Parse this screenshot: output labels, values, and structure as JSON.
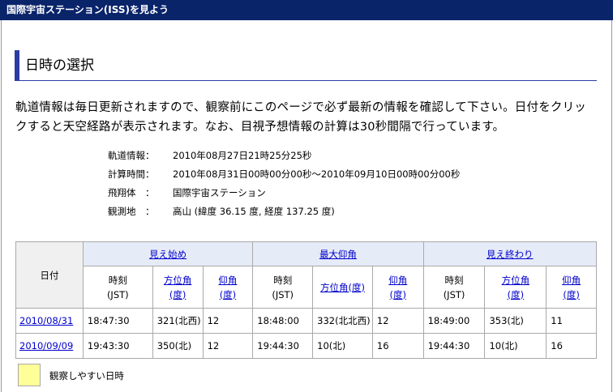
{
  "window": {
    "title": "国際宇宙ステーション(ISS)を見よう"
  },
  "section": {
    "title": "日時の選択"
  },
  "intro": "軌道情報は毎日更新されますので、観察前にこのページで必ず最新の情報を確認して下さい。日付をクリックすると天空経路が表示されます。なお、目視予想情報の計算は30秒間隔で行っています。",
  "info": {
    "orbit_label": "軌道情報：",
    "orbit_value": "2010年08月27日21時25分25秒",
    "calc_label": "計算時間：",
    "calc_value": "2010年08月31日00時00分00秒〜2010年09月10日00時00分00秒",
    "vehicle_label": "飛翔体　：",
    "vehicle_value": "国際宇宙ステーション",
    "site_label": "観測地　：",
    "site_value": "高山 (緯度 36.15 度, 経度 137.25 度)"
  },
  "table": {
    "date_header": "日付",
    "groups": {
      "start": "見え始め",
      "max": "最大仰角",
      "end": "見え終わり"
    },
    "sub": {
      "time1": "時刻",
      "time2": "(JST)",
      "azimuth1": "方位角",
      "azimuth2": "(度)",
      "azimuth_deg": "方位角(度)",
      "elev1": "仰角",
      "elev2": "(度)"
    },
    "rows": [
      {
        "date": "2010/08/31",
        "start_time": "18:47:30",
        "start_az": "321(北西)",
        "start_el": "12",
        "max_time": "18:48:00",
        "max_az": "332(北北西)",
        "max_el": "12",
        "end_time": "18:49:00",
        "end_az": "353(北)",
        "end_el": "11"
      },
      {
        "date": "2010/09/09",
        "start_time": "19:43:30",
        "start_az": "350(北)",
        "start_el": "12",
        "max_time": "19:44:30",
        "max_az": "10(北)",
        "max_el": "16",
        "end_time": "19:44:30",
        "end_az": "10(北)",
        "end_el": "16"
      }
    ]
  },
  "legend": {
    "text": "観察しやすい日時",
    "color": "#ffff99"
  }
}
